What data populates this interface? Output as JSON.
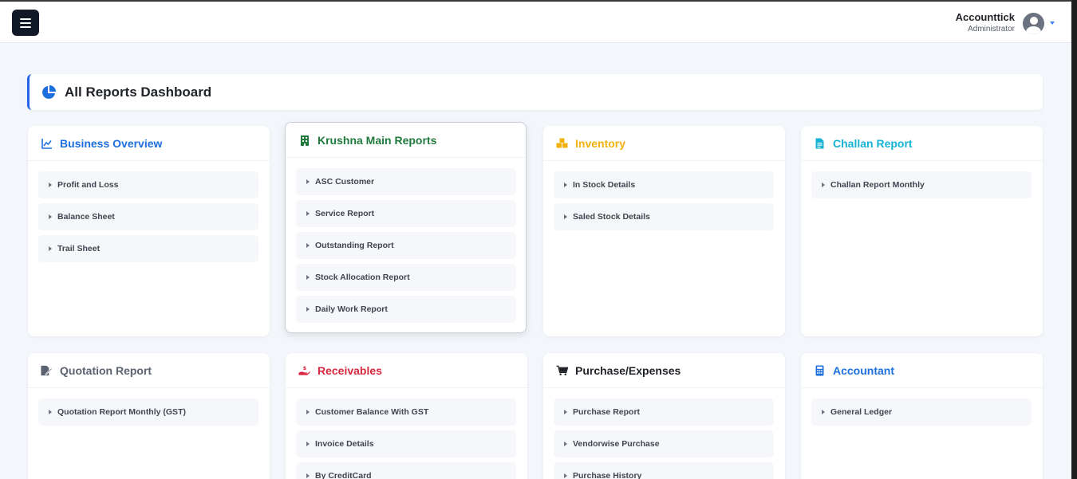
{
  "app": {
    "user_name": "Accounttick",
    "user_role": "Administrator"
  },
  "page": {
    "title": "All Reports Dashboard"
  },
  "colors": {
    "blue": "#1d6fe0",
    "green": "#1f7a3e",
    "yellow": "#f2b10f",
    "cyan": "#15b3d3",
    "gray": "#5b6370",
    "red": "#d7263d",
    "dark": "#1f2328"
  },
  "cards": {
    "business": {
      "title": "Business Overview",
      "icon": "line-chart-icon",
      "items": [
        "Profit and Loss",
        "Balance Sheet",
        "Trail Sheet"
      ]
    },
    "krushna": {
      "title": "Krushna Main Reports",
      "icon": "building-icon",
      "items": [
        "ASC Customer",
        "Service Report",
        "Outstanding Report",
        "Stock Allocation Report",
        "Daily Work Report"
      ]
    },
    "inventory": {
      "title": "Inventory",
      "icon": "boxes-icon",
      "items": [
        "In Stock Details",
        "Saled Stock Details"
      ]
    },
    "challan": {
      "title": "Challan Report",
      "icon": "document-icon",
      "items": [
        "Challan Report Monthly"
      ]
    },
    "quotation": {
      "title": "Quotation Report",
      "icon": "signature-icon",
      "items": [
        "Quotation Report Monthly (GST)"
      ]
    },
    "receivables": {
      "title": "Receivables",
      "icon": "hand-coin-icon",
      "items": [
        "Customer Balance With GST",
        "Invoice Details",
        "By CreditCard"
      ]
    },
    "purchase": {
      "title": "Purchase/Expenses",
      "icon": "cart-icon",
      "items": [
        "Purchase Report",
        "Vendorwise Purchase",
        "Purchase History"
      ]
    },
    "accountant": {
      "title": "Accountant",
      "icon": "calculator-icon",
      "items": [
        "General Ledger"
      ]
    }
  }
}
